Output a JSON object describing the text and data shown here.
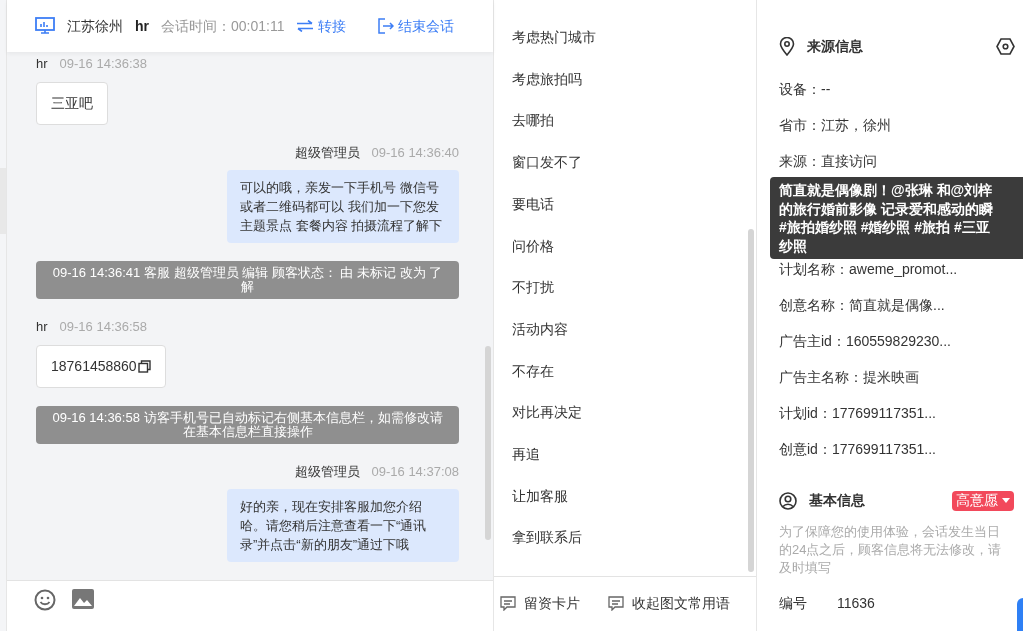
{
  "header": {
    "location": "江苏徐州",
    "user": "hr",
    "session_label": "会话时间：",
    "session_time": "00:01:11",
    "transfer": "转接",
    "end": "结束会话"
  },
  "messages": [
    {
      "kind": "customer",
      "sender": "hr",
      "time": "09-16 14:36:38",
      "text": "三亚吧",
      "copyable": false
    },
    {
      "kind": "agent",
      "sender": "超级管理员",
      "time": "09-16 14:36:40",
      "text": "可以的哦，亲发一下手机号 微信号或者二维码都可以 我们加一下您发主题景点 套餐内容 拍摄流程了解下"
    },
    {
      "kind": "system",
      "text": "09-16 14:36:41 客服 超级管理员 编辑 顾客状态： 由 未标记 改为 了解"
    },
    {
      "kind": "customer",
      "sender": "hr",
      "time": "09-16 14:36:58",
      "text": "18761458860",
      "copyable": true
    },
    {
      "kind": "system",
      "text": "09-16 14:36:58 访客手机号已自动标记右侧基本信息栏，如需修改请在基本信息栏直接操作"
    },
    {
      "kind": "agent",
      "sender": "超级管理员",
      "time": "09-16 14:37:08",
      "text": "好的亲，现在安排客服加您介绍哈。请您稍后注意查看一下“通讯录”并点击“新的朋友”通过下哦"
    }
  ],
  "quick_replies": [
    "考虑热门城市",
    "考虑旅拍吗",
    "去哪拍",
    "窗口发不了",
    "要电话",
    "问价格",
    "不打扰",
    "活动内容",
    "不存在",
    "对比再决定",
    "再追",
    "让加客服",
    "拿到联系后"
  ],
  "quick_footer": {
    "card": "留资卡片",
    "collapse": "收起图文常用语"
  },
  "source_info": {
    "title": "来源信息",
    "rows_top": [
      "设备：--",
      "省市：江苏，徐州",
      "来源：直接访问"
    ],
    "rows_bottom": [
      "计划名称：aweme_promot...",
      "创意名称：简直就是偶像...",
      "广告主id：160559829230...",
      "广告主名称：提米映画",
      "计划id：177699117351...",
      "创意id：177699117351..."
    ],
    "tooltip": [
      "简直就是偶像剧！@张琳 和@刘梓",
      "的旅行婚前影像 记录爱和感动的瞬",
      "#旅拍婚纱照 #婚纱照 #旅拍 #三亚",
      "纱照"
    ]
  },
  "basic_info": {
    "title": "基本信息",
    "intent": "高意愿",
    "notice": "为了保障您的使用体验，会话发生当日的24点之后，顾客信息将无法修改，请及时填写",
    "fields": [
      {
        "label": "编号",
        "value": "11636"
      }
    ]
  }
}
